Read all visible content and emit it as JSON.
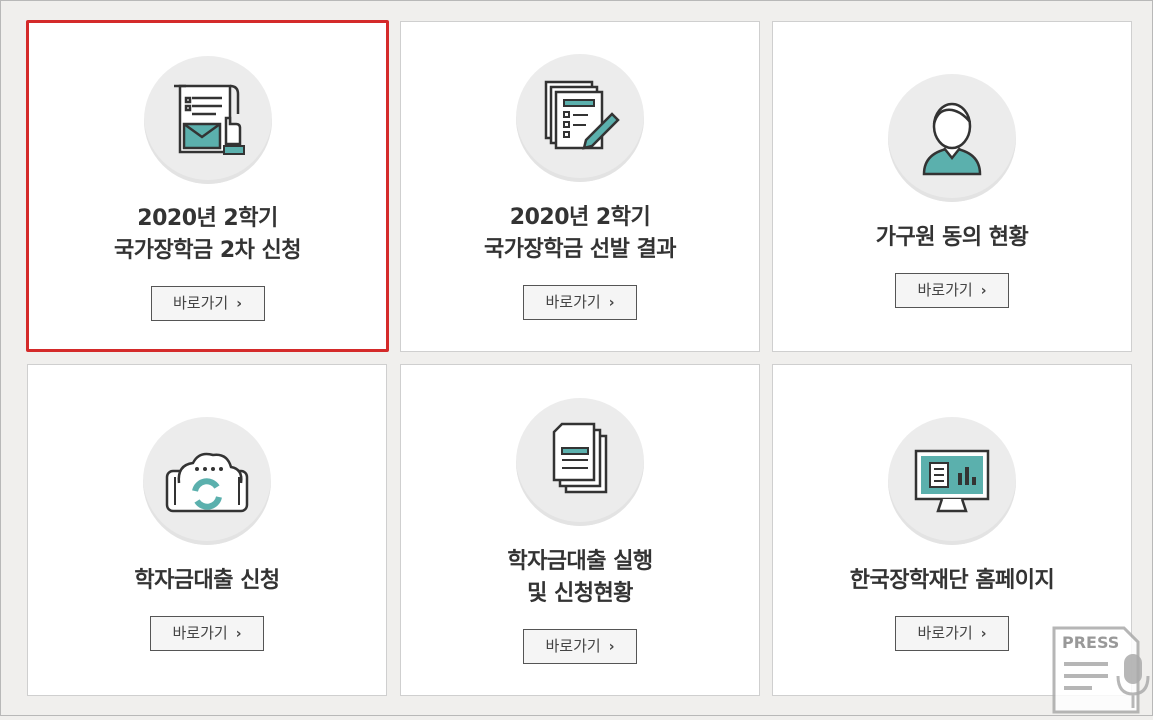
{
  "cards": [
    {
      "title_line1": "2020년 2학기",
      "title_line2": "국가장학금 2차 신청",
      "button": "바로가기",
      "icon": "letter-document-icon",
      "selected": true
    },
    {
      "title_line1": "2020년 2학기",
      "title_line2": "국가장학금 선발 결과",
      "button": "바로가기",
      "icon": "documents-pen-icon",
      "selected": false
    },
    {
      "title_line1": "가구원 동의 현황",
      "title_line2": "",
      "button": "바로가기",
      "icon": "person-icon",
      "selected": false
    },
    {
      "title_line1": "학자금대출 신청",
      "title_line2": "",
      "button": "바로가기",
      "icon": "cloud-sync-tablet-icon",
      "selected": false
    },
    {
      "title_line1": "학자금대출 실행",
      "title_line2": "및 신청현황",
      "button": "바로가기",
      "icon": "document-stack-icon",
      "selected": false
    },
    {
      "title_line1": "한국장학재단 홈페이지",
      "title_line2": "",
      "button": "바로가기",
      "icon": "monitor-icon",
      "selected": false
    }
  ],
  "press_badge": {
    "label": "PRESS",
    "icon": "press-microphone-icon"
  },
  "colors": {
    "accent_teal": "#5bb0ad",
    "selection_red": "#d42a2a",
    "icon_dark": "#333333"
  }
}
